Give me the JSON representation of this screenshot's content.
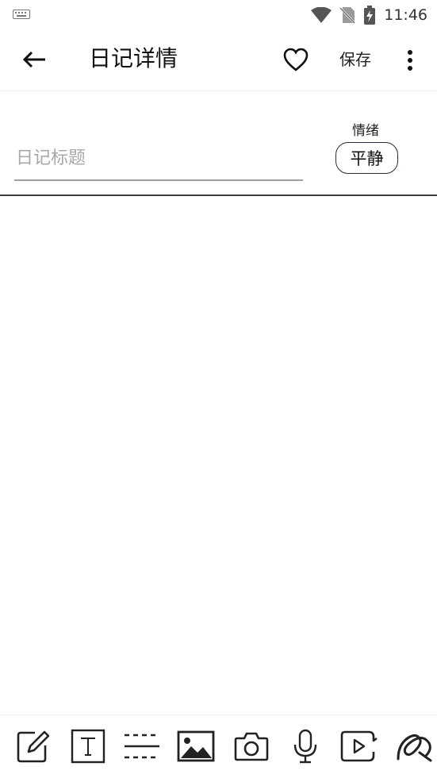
{
  "status_bar": {
    "time": "11:46",
    "icons": [
      "keyboard-icon",
      "wifi-icon",
      "no-sim-icon",
      "battery-charging-icon"
    ]
  },
  "app_bar": {
    "back_icon": "arrow-left-icon",
    "title": "日记详情",
    "favorite_icon": "heart-outline-icon",
    "save_label": "保存",
    "more_icon": "more-vertical-icon"
  },
  "editor": {
    "title_placeholder": "日记标题",
    "title_value": "",
    "mood_label": "情绪",
    "mood_value": "平静"
  },
  "toolbar": {
    "tools": [
      {
        "name": "edit",
        "icon": "pencil-square-icon"
      },
      {
        "name": "text",
        "icon": "text-box-icon"
      },
      {
        "name": "divider",
        "icon": "divider-lines-icon"
      },
      {
        "name": "image",
        "icon": "image-icon"
      },
      {
        "name": "camera",
        "icon": "camera-icon"
      },
      {
        "name": "voice",
        "icon": "microphone-icon"
      },
      {
        "name": "video",
        "icon": "video-play-icon"
      },
      {
        "name": "draw",
        "icon": "brush-doodle-icon"
      }
    ]
  },
  "colors": {
    "background": "#ffffff",
    "divider": "#3a3a3a",
    "placeholder": "#a8a8a8",
    "icon": "#222222"
  }
}
